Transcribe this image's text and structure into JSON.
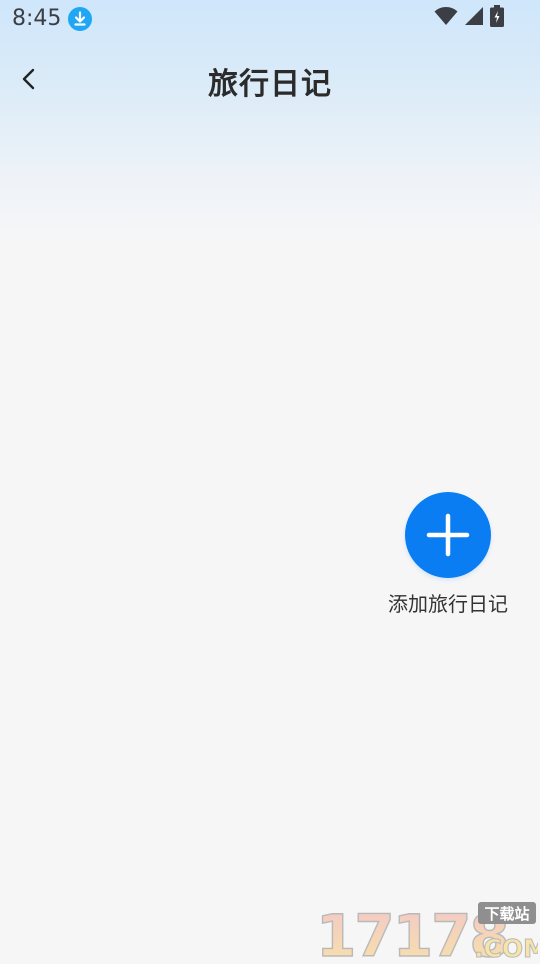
{
  "status_bar": {
    "time": "8:45",
    "icons": [
      "download-notification-icon",
      "wifi-icon",
      "cellular-signal-icon",
      "battery-charging-icon"
    ]
  },
  "header": {
    "title": "旅行日记",
    "back_icon": "chevron-left-icon"
  },
  "main": {
    "add_button_icon": "plus-icon",
    "add_label": "添加旅行日记"
  },
  "watermark": {
    "number": "17178",
    "badge": "下载站",
    "suffix": ".COM"
  },
  "colors": {
    "accent": "#0a7df2",
    "status_download": "#1fa6f4",
    "title_text": "#2b2b2b",
    "background": "#f6f6f7"
  }
}
